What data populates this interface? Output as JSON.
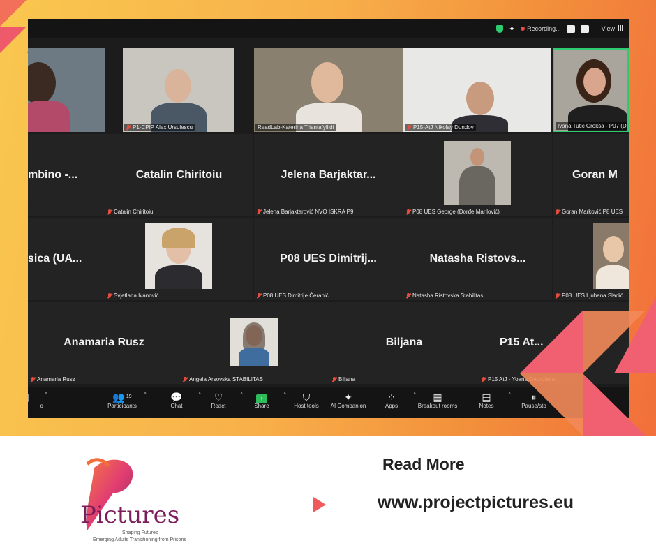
{
  "meeting": {
    "recording_label": "Recording...",
    "view_label": "View"
  },
  "tiles": [
    {
      "label": "",
      "big": "",
      "kind": "video"
    },
    {
      "label": "P1-CPIP Alex Ursulescu",
      "big": "",
      "kind": "video"
    },
    {
      "label": "ReadLab-Katerina Triantafyllidi",
      "big": "",
      "kind": "video"
    },
    {
      "label": "P15-AtJ Nikolay Dundov",
      "big": "",
      "kind": "video"
    },
    {
      "label": "Ivana Tutić Grokša - P07 (D",
      "big": "",
      "kind": "video"
    },
    {
      "label": "",
      "big": "mbino -...",
      "kind": "name"
    },
    {
      "label": "Catalin Chiritoiu",
      "big": "Catalin Chiritoiu",
      "kind": "name"
    },
    {
      "label": "Jelena Barjaktarović NVO ISKRA P9",
      "big": "Jelena Barjaktar...",
      "kind": "name"
    },
    {
      "label": "P08 UES George (Đorđe Marilović)",
      "big": "",
      "kind": "photo"
    },
    {
      "label": "Goran Marković P8 UES",
      "big": "Goran M",
      "kind": "name"
    },
    {
      "label": "",
      "big": "sica (UA...",
      "kind": "name"
    },
    {
      "label": "Svjetlana Ivanović",
      "big": "",
      "kind": "photo"
    },
    {
      "label": "P08 UES Dimitrije Ćeranić",
      "big": "P08 UES Dimitrij...",
      "kind": "name"
    },
    {
      "label": "Natasha Ristovska Stabilitas",
      "big": "Natasha Ristovs...",
      "kind": "name"
    },
    {
      "label": "P08 UES Ljubana Sladić",
      "big": "",
      "kind": "photo"
    },
    {
      "label": "Anamaria Rusz",
      "big": "Anamaria Rusz",
      "kind": "name"
    },
    {
      "label": "Angela Arsovska STABILITAS",
      "big": "",
      "kind": "photo"
    },
    {
      "label": "Biljana",
      "big": "Biljana",
      "kind": "name"
    },
    {
      "label": "P15 AtJ - Yoana Georgieva",
      "big": "P15 At...",
      "kind": "name"
    }
  ],
  "toolbar": {
    "participants": "Participants",
    "participants_count": "19",
    "chat": "Chat",
    "react": "React",
    "share": "Share",
    "host_tools": "Host tools",
    "ai_companion": "AI Companion",
    "apps": "Apps",
    "breakout": "Breakout rooms",
    "notes": "Notes",
    "pause": "Pause/sto",
    "more": "More",
    "left_partial": "o"
  },
  "footer": {
    "read_more": "Read More",
    "url": "www.projectpictures.eu",
    "logo_word": "Pictures",
    "tagline1": "Shaping Futures",
    "tagline2": "Emerging Adults Transitioning from Prisons"
  },
  "colors": {
    "accent_red": "#f05a5a",
    "brand_purple": "#7b1e5a",
    "zoom_bg": "#1c1c1c"
  }
}
